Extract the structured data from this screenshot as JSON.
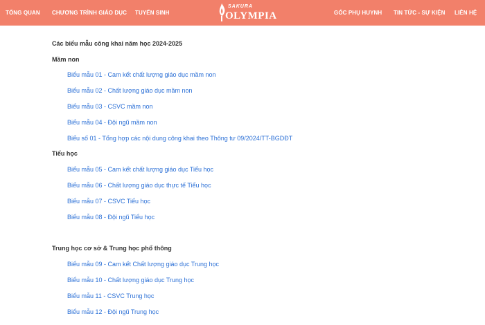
{
  "nav": {
    "items": [
      {
        "label": "TỔNG QUAN"
      },
      {
        "label": "CHƯƠNG TRÌNH GIÁO DỤC"
      },
      {
        "label": "TUYỂN SINH"
      },
      {
        "label": "GÓC PHỤ HUYNH"
      },
      {
        "label": "TIN TỨC - SỰ KIỆN"
      },
      {
        "label": "LIÊN HỆ"
      }
    ],
    "logo_top": "SAKURA",
    "logo_main": "OLYMPIA",
    "bg_color": "#f2806a"
  },
  "content": {
    "title": "Các biểu mẫu công khai năm học 2024-2025",
    "sections": [
      {
        "heading": "Mầm non",
        "links": [
          "Biểu mẫu 01 - Cam kết chất lượng giáo dục mầm non",
          "Biểu mẫu 02 - Chất lượng giáo dục mầm non",
          "Biểu mẫu 03 - CSVC mầm non",
          "Biểu mẫu 04 - Đội ngũ mầm non",
          "Biểu số 01 - Tổng hợp các nội dung công khai theo Thông tư 09/2024/TT-BGDĐT"
        ]
      },
      {
        "heading": "Tiểu học",
        "links": [
          "Biểu mẫu 05 - Cam kết chất lượng giáo dục Tiểu học",
          "Biểu mẫu 06 - Chất lượng giáo dục thực tế Tiểu học",
          "Biểu mẫu 07 - CSVC Tiểu học",
          "Biểu mẫu 08 - Đội ngũ Tiểu học"
        ]
      },
      {
        "heading": "Trung học cơ sở & Trung học phổ thông",
        "links": [
          "Biểu mẫu 09 - Cam kết Chất lượng giáo dục Trung học",
          "Biểu mẫu 10 - Chất lượng giáo dục Trung học",
          "Biểu mẫu 11 - CSVC Trung học",
          "Biểu mẫu 12 - Đội ngũ Trung học"
        ]
      }
    ],
    "link_color": "#2a6fd6"
  }
}
